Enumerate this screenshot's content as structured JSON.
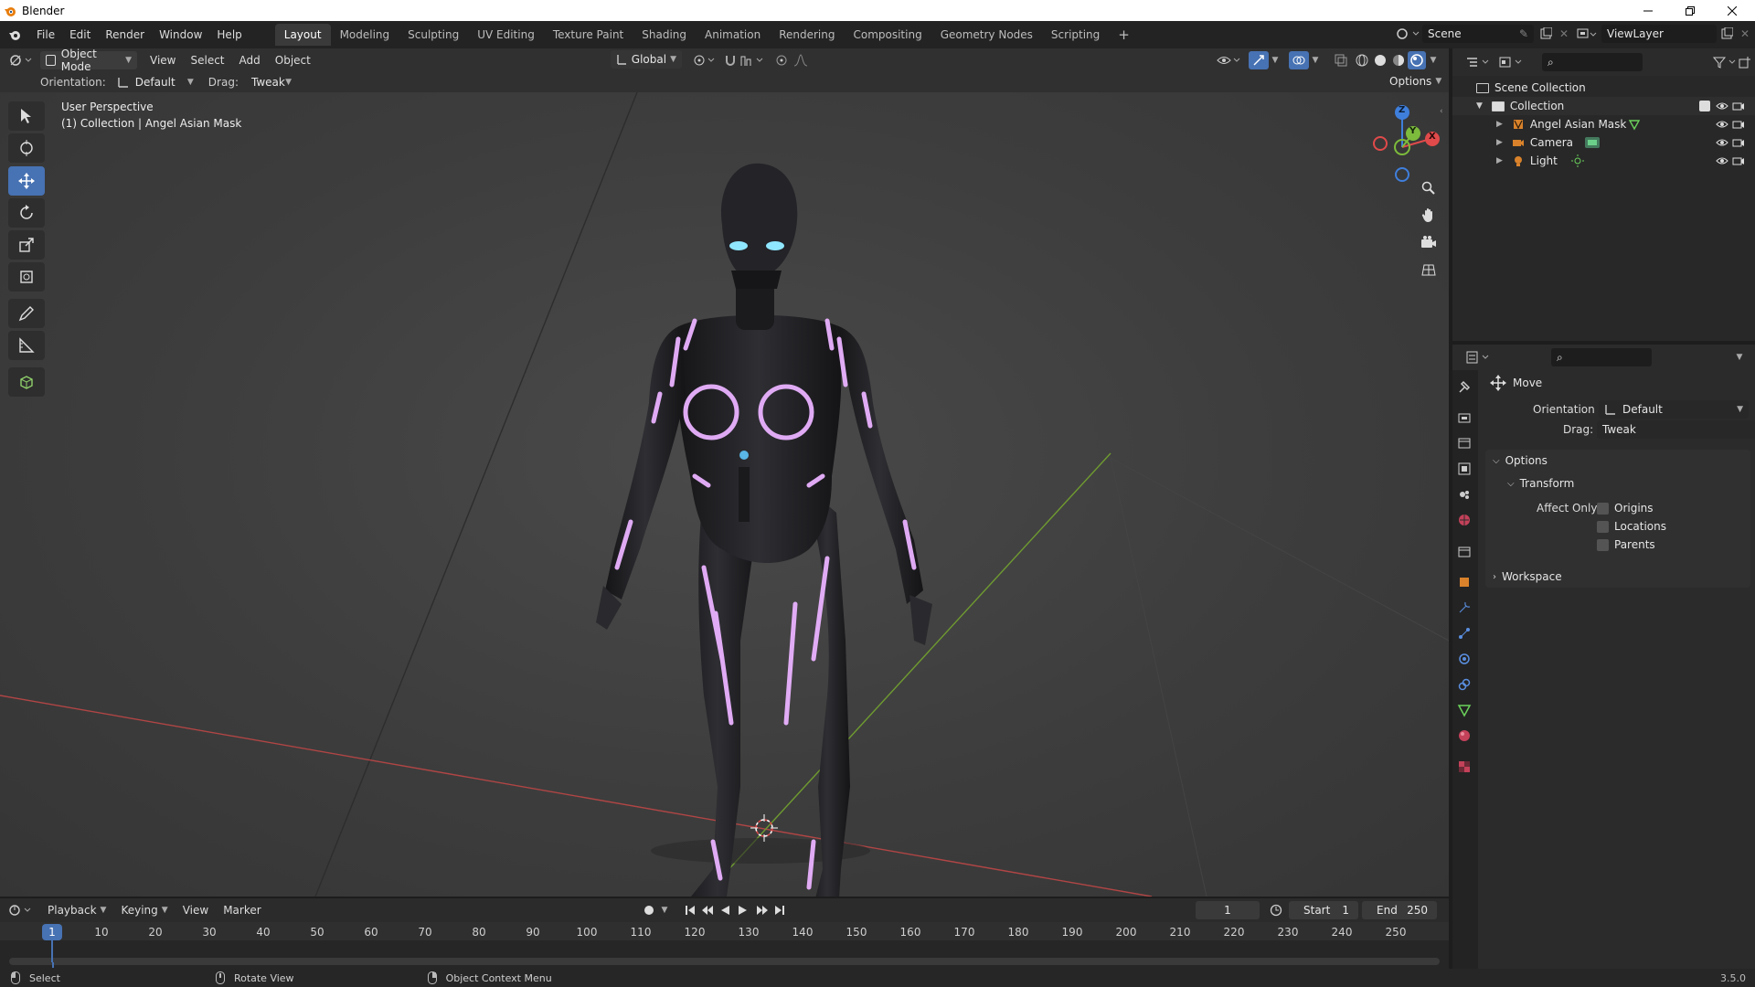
{
  "window": {
    "title": "Blender"
  },
  "menu": [
    "File",
    "Edit",
    "Render",
    "Window",
    "Help"
  ],
  "workspaces": [
    "Layout",
    "Modeling",
    "Sculpting",
    "UV Editing",
    "Texture Paint",
    "Shading",
    "Animation",
    "Rendering",
    "Compositing",
    "Geometry Nodes",
    "Scripting"
  ],
  "add_workspace": "+",
  "scene": {
    "label": "Scene",
    "viewlayer": "ViewLayer"
  },
  "viewport_header": {
    "mode": "Object Mode",
    "menus": [
      "View",
      "Select",
      "Add",
      "Object"
    ],
    "transform_orientation": "Global"
  },
  "tool_settings": {
    "orientation_label": "Orientation:",
    "orientation_value": "Default",
    "drag_label": "Drag:",
    "drag_value": "Tweak",
    "options": "Options"
  },
  "viewport": {
    "perspective": "User Perspective",
    "collection_info": "(1) Collection | Angel Asian Mask",
    "gizmo": {
      "z": "Z",
      "y": "Y",
      "x": "X"
    }
  },
  "outliner": {
    "root": "Scene Collection",
    "collection": "Collection",
    "items": [
      {
        "name": "Angel Asian Mask",
        "icon": "mesh-icon"
      },
      {
        "name": "Camera",
        "icon": "camera-icon"
      },
      {
        "name": "Light",
        "icon": "light-icon"
      }
    ]
  },
  "properties": {
    "tool_name": "Move",
    "orientation_label": "Orientation",
    "orientation_value": "Default",
    "drag_label": "Drag:",
    "drag_value": "Tweak",
    "options_panel": "Options",
    "transform_panel": "Transform",
    "affect_only_label": "Affect Only",
    "affect_only": [
      "Origins",
      "Locations",
      "Parents"
    ],
    "workspace_panel": "Workspace"
  },
  "timeline": {
    "menus": [
      "Playback",
      "Keying",
      "View",
      "Marker"
    ],
    "current_frame": "1",
    "start_label": "Start",
    "start": "1",
    "end_label": "End",
    "end": "250",
    "ruler": [
      "1",
      "10",
      "20",
      "30",
      "40",
      "50",
      "60",
      "70",
      "80",
      "90",
      "100",
      "110",
      "120",
      "130",
      "140",
      "150",
      "160",
      "170",
      "180",
      "190",
      "200",
      "210",
      "220",
      "230",
      "240",
      "250"
    ]
  },
  "status": {
    "select": "Select",
    "rotate": "Rotate View",
    "context": "Object Context Menu",
    "version": "3.5.0"
  },
  "colors": {
    "accent": "#4772b3",
    "x_axis": "#e04a4a",
    "y_axis": "#7dbb3c",
    "z_axis": "#3f7fdc",
    "glow": "#e8a6f5"
  }
}
